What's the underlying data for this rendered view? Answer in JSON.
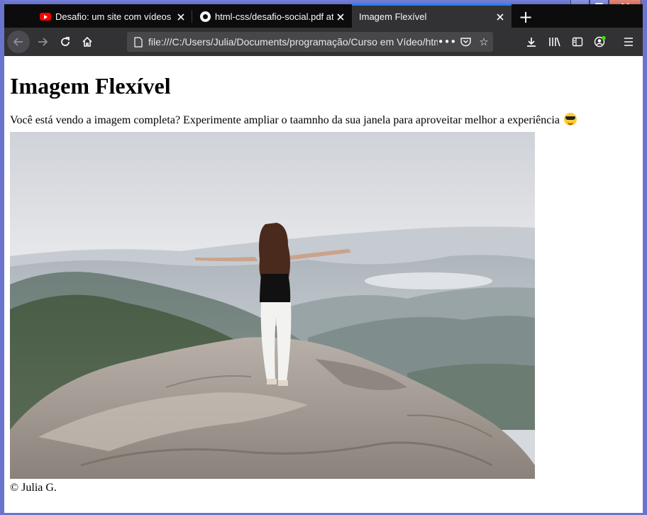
{
  "browser": {
    "tabs": [
      {
        "title": "Desafio: um site com vídeos - G",
        "icon": "youtube-icon",
        "active": false
      },
      {
        "title": "html-css/desafio-social.pdf at m",
        "icon": "github-icon",
        "active": false
      },
      {
        "title": "Imagem Flexível",
        "icon": "none",
        "active": true
      }
    ],
    "new_tab_label": "+",
    "url": "file:///C:/Users/Julia/Documents/programação/Curso em Vídeo/html",
    "accent_color": "#0a84ff"
  },
  "page": {
    "heading": "Imagem Flexível",
    "lead": "Você está vendo a imagem completa? Experimente ampliar o taamnho da sua janela para aproveitar melhor a experiência",
    "emoji": "smiling-face-with-sunglasses",
    "image_description_icon": "woman-on-mountain-photo",
    "caption": "© Julia G."
  }
}
